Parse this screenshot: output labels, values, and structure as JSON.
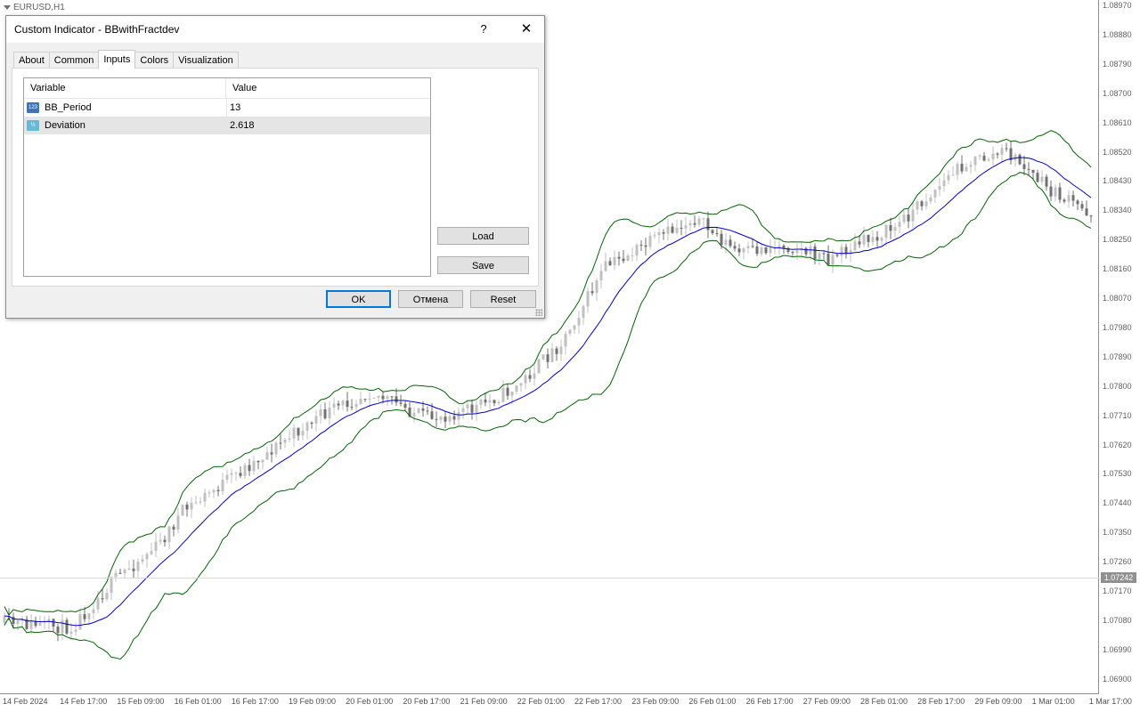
{
  "chart": {
    "symbol": "EURUSD,H1",
    "current_price": "1.07242",
    "price_labels": [
      "1.08970",
      "1.08880",
      "1.08790",
      "1.08700",
      "1.08610",
      "1.08520",
      "1.08430",
      "1.08340",
      "1.08250",
      "1.08160",
      "1.08070",
      "1.07980",
      "1.07890",
      "1.07800",
      "1.07710",
      "1.07620",
      "1.07530",
      "1.07440",
      "1.07350",
      "1.07260",
      "1.07170",
      "1.07080",
      "1.06990",
      "1.06900"
    ],
    "date_labels": [
      "14 Feb 2024",
      "14 Feb 17:00",
      "15 Feb 09:00",
      "16 Feb 01:00",
      "16 Feb 17:00",
      "19 Feb 09:00",
      "20 Feb 01:00",
      "20 Feb 17:00",
      "21 Feb 09:00",
      "22 Feb 01:00",
      "22 Feb 17:00",
      "23 Feb 09:00",
      "26 Feb 01:00",
      "26 Feb 17:00",
      "27 Feb 09:00",
      "28 Feb 01:00",
      "28 Feb 17:00",
      "29 Feb 09:00",
      "1 Mar 01:00",
      "1 Mar 17:00"
    ],
    "colors": {
      "band": "#006400",
      "middle": "#0000cd",
      "bull": "#c0c0c0",
      "bear": "#707070",
      "grid": "#e8e8e8"
    }
  },
  "dialog": {
    "title": "Custom Indicator - BBwithFractdev",
    "help_label": "?",
    "close_label": "✕",
    "tabs": [
      {
        "label": "About",
        "active": false
      },
      {
        "label": "Common",
        "active": false
      },
      {
        "label": "Inputs",
        "active": true
      },
      {
        "label": "Colors",
        "active": false
      },
      {
        "label": "Visualization",
        "active": false
      }
    ],
    "table": {
      "headers": {
        "variable": "Variable",
        "value": "Value"
      },
      "rows": [
        {
          "icon": "int-type-icon",
          "icon_text": "123",
          "variable": "BB_Period",
          "value": "13",
          "selected": false
        },
        {
          "icon": "double-type-icon",
          "icon_text": "½",
          "variable": "Deviation",
          "value": "2.618",
          "selected": true
        }
      ]
    },
    "buttons": {
      "load": "Load",
      "save": "Save",
      "ok": "OK",
      "cancel": "Отмена",
      "reset": "Reset"
    }
  }
}
